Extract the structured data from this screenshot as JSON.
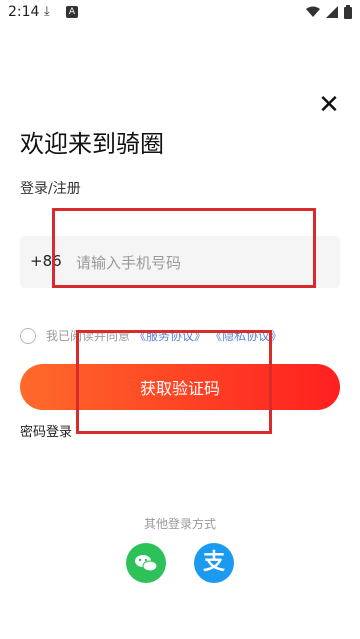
{
  "status": {
    "time": "2:14",
    "download_icon": "download-icon",
    "a_badge": "A"
  },
  "header": {
    "close": "✕"
  },
  "title": "欢迎来到骑圈",
  "subtitle": "登录/注册",
  "phone": {
    "country_code": "+86",
    "placeholder": "请输入手机号码",
    "value": ""
  },
  "agreement": {
    "text": "我已阅读并同意",
    "service": "《服务协议》",
    "privacy": "《隐私协议》"
  },
  "get_code_label": "获取验证码",
  "password_login_label": "密码登录",
  "other_login_label": "其他登录方式",
  "alipay_glyph": "支",
  "colors": {
    "accent_start": "#ff6a2a",
    "accent_end": "#ff1f1f",
    "link": "#5b7fd6",
    "wechat": "#2dc15a",
    "alipay": "#1b9bf0",
    "annotation": "#d92b2b"
  }
}
